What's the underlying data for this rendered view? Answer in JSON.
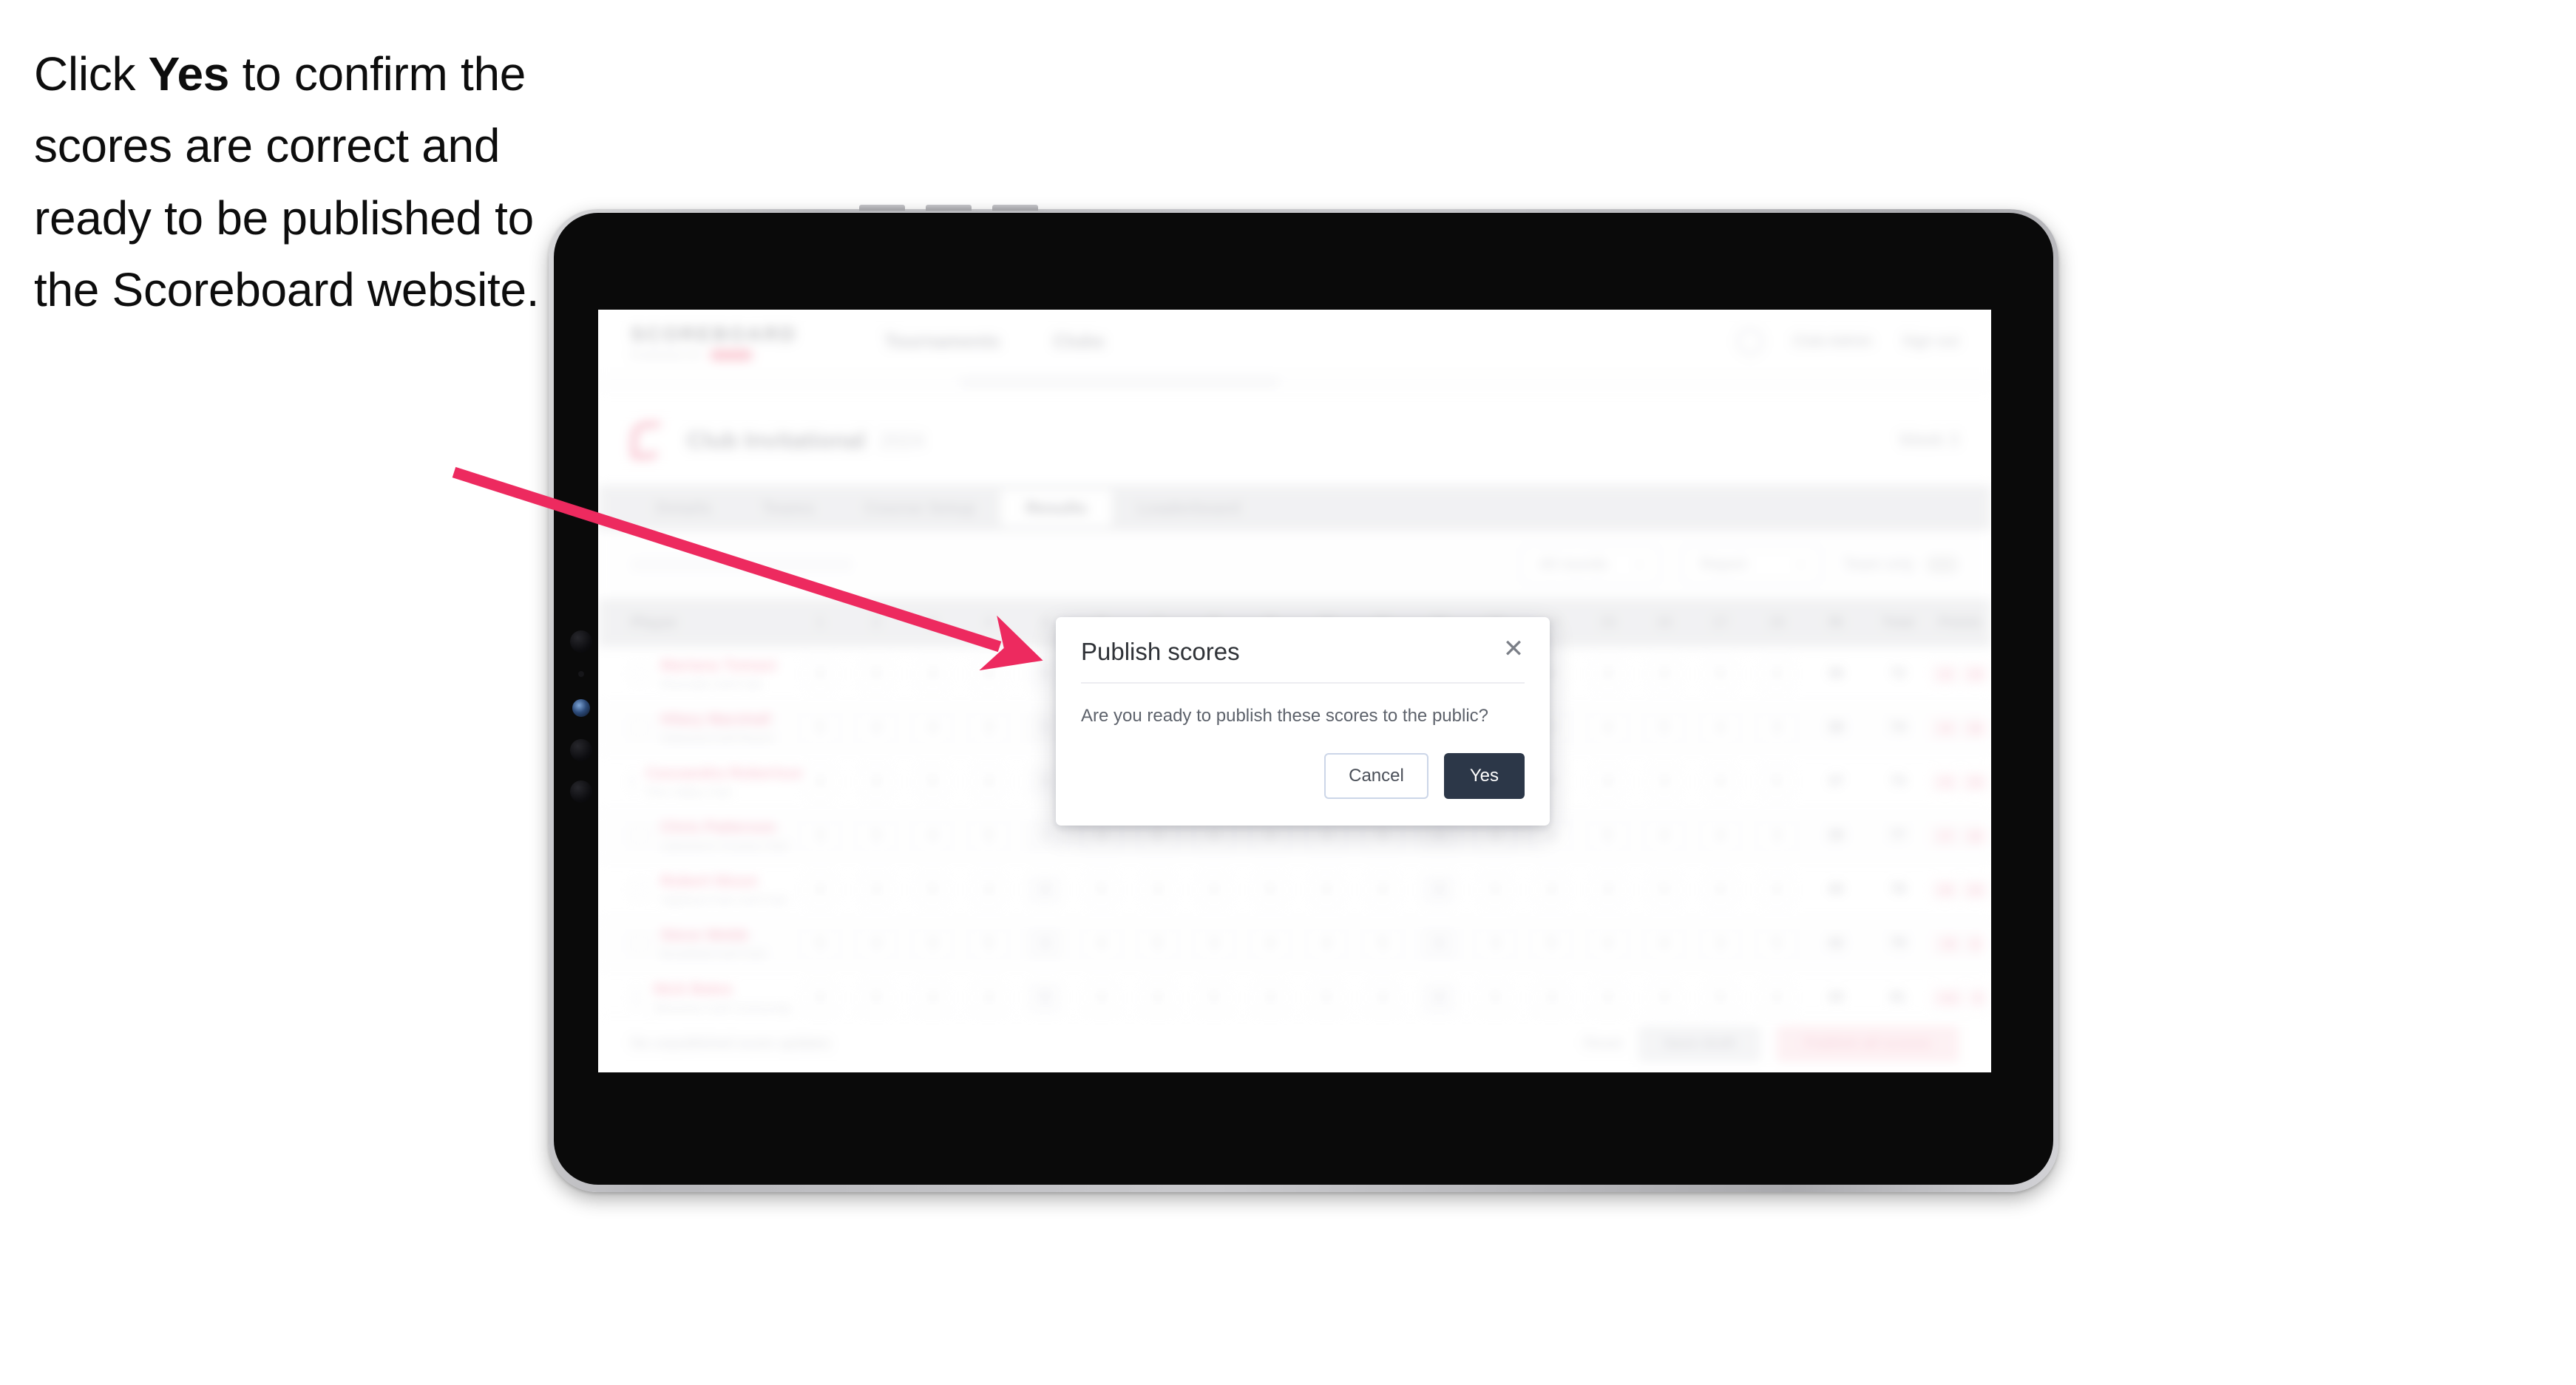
{
  "caption": {
    "part1": "Click ",
    "emphasis": "Yes",
    "part2": " to confirm the scores are correct and ready to be published to the Scoreboard website."
  },
  "colors": {
    "arrow_pink": "#ED2A5F",
    "brand_pink": "#EF5C80",
    "yes_button": "#2C3748",
    "cancel_border": "#CCD6E8",
    "device_bezel": "#0A0A0A"
  },
  "modal": {
    "title": "Publish scores",
    "message": "Are you ready to publish these scores to the public?",
    "close_icon": "close-icon",
    "cancel_label": "Cancel",
    "yes_label": "Yes"
  },
  "app": {
    "brand": {
      "wordmark": "SCOREBOARD",
      "subtitle": "POWERED BY"
    },
    "nav": [
      "Tournaments",
      "Clubs"
    ],
    "header_right": {
      "account_icon": "user-avatar-icon",
      "links": [
        "Club Admin",
        "Sign out"
      ]
    },
    "title_row": {
      "icon": "flag-icon",
      "main": "Club Invitational",
      "sub": "2024",
      "right": "Week 3"
    },
    "tabs": [
      {
        "label": "Details",
        "active": false
      },
      {
        "label": "Teams",
        "active": false
      },
      {
        "label": "Course Setup",
        "active": false
      },
      {
        "label": "Results",
        "active": true
      },
      {
        "label": "Leaderboard",
        "active": false
      }
    ],
    "filters": {
      "round_select": "All rounds",
      "round_chevron": "chevron-down-icon",
      "report_select": "Report",
      "report_chevron": "chevron-down-icon",
      "toggle_label": "Team only",
      "toggle_state": "off"
    },
    "table": {
      "player_header": "Player",
      "hole_headers": [
        "1",
        "2",
        "3",
        "4",
        "5",
        "6",
        "7",
        "8",
        "9",
        "10",
        "11",
        "12",
        "13",
        "14",
        "15",
        "16",
        "17",
        "18"
      ],
      "wide_headers": [
        "IN",
        "Total",
        "Points"
      ],
      "rows": [
        {
          "name": "Mariana Tomasi",
          "club": "Riverside Golf Club",
          "scores": [
            "4",
            "5",
            "3",
            "4",
            "5",
            "4",
            "3",
            "5",
            "4",
            "4",
            "3",
            "5",
            "4",
            "4",
            "3",
            "4",
            "5",
            "4"
          ],
          "total": "36",
          "net": "72",
          "points": [
            "+2",
            "18"
          ]
        },
        {
          "name": "Hilary Marshall",
          "club": "Oakwood Golf Resort",
          "scores": [
            "5",
            "4",
            "4",
            "3",
            "5",
            "4",
            "4",
            "4",
            "5",
            "3",
            "4",
            "4",
            "5",
            "3",
            "4",
            "5",
            "4",
            "3"
          ],
          "total": "38",
          "net": "74",
          "points": [
            "+4",
            "16"
          ]
        },
        {
          "name": "Cassandra Robertson",
          "club": "Pine Valley Club",
          "scores": [
            "4",
            "4",
            "5",
            "4",
            "3",
            "5",
            "4",
            "3",
            "4",
            "5",
            "4",
            "3",
            "4",
            "5",
            "4",
            "3",
            "4",
            "5"
          ],
          "total": "37",
          "net": "73",
          "points": [
            "+3",
            "15"
          ]
        },
        {
          "name": "Chris Patterson",
          "club": "Lakeshore Country Club",
          "scores": [
            "3",
            "5",
            "4",
            "5",
            "4",
            "3",
            "5",
            "4",
            "4",
            "3",
            "5",
            "4",
            "3",
            "4",
            "5",
            "4",
            "4",
            "3"
          ],
          "total": "39",
          "net": "77",
          "points": [
            "+7",
            "12"
          ]
        },
        {
          "name": "Robert Nixon",
          "club": "Highland Park Golf Club",
          "scores": [
            "4",
            "3",
            "5",
            "4",
            "4",
            "5",
            "3",
            "4",
            "5",
            "4",
            "4",
            "3",
            "5",
            "4",
            "3",
            "5",
            "4",
            "4"
          ],
          "total": "40",
          "net": "78",
          "points": [
            "+8",
            "10"
          ]
        },
        {
          "name": "Steve Webb",
          "club": "Brookfield Golf Club",
          "scores": [
            "5",
            "4",
            "3",
            "5",
            "4",
            "4",
            "5",
            "3",
            "4",
            "4",
            "5",
            "4",
            "3",
            "5",
            "4",
            "4",
            "3",
            "5"
          ],
          "total": "42",
          "net": "79",
          "points": [
            "+9",
            "8"
          ]
        },
        {
          "name": "Nick Bates",
          "club": "Westview Golf Community",
          "scores": [
            "4",
            "5",
            "4",
            "3",
            "5",
            "4",
            "4",
            "5",
            "3",
            "5",
            "4",
            "4",
            "5",
            "3",
            "4",
            "4",
            "5",
            "4"
          ],
          "total": "43",
          "net": "81",
          "points": [
            "+11",
            "6"
          ]
        }
      ]
    },
    "bottom_bar": {
      "note": "No unpublished score updates",
      "link": "Reset",
      "secondary_button": "Save draft",
      "primary_button": "Publish all scores"
    }
  },
  "device": {
    "type": "tablet",
    "camera_icon": "front-camera-icon",
    "sensor_icon": "ambient-sensor-icon"
  },
  "annotation": {
    "arrow_icon": "pointer-arrow-icon"
  }
}
